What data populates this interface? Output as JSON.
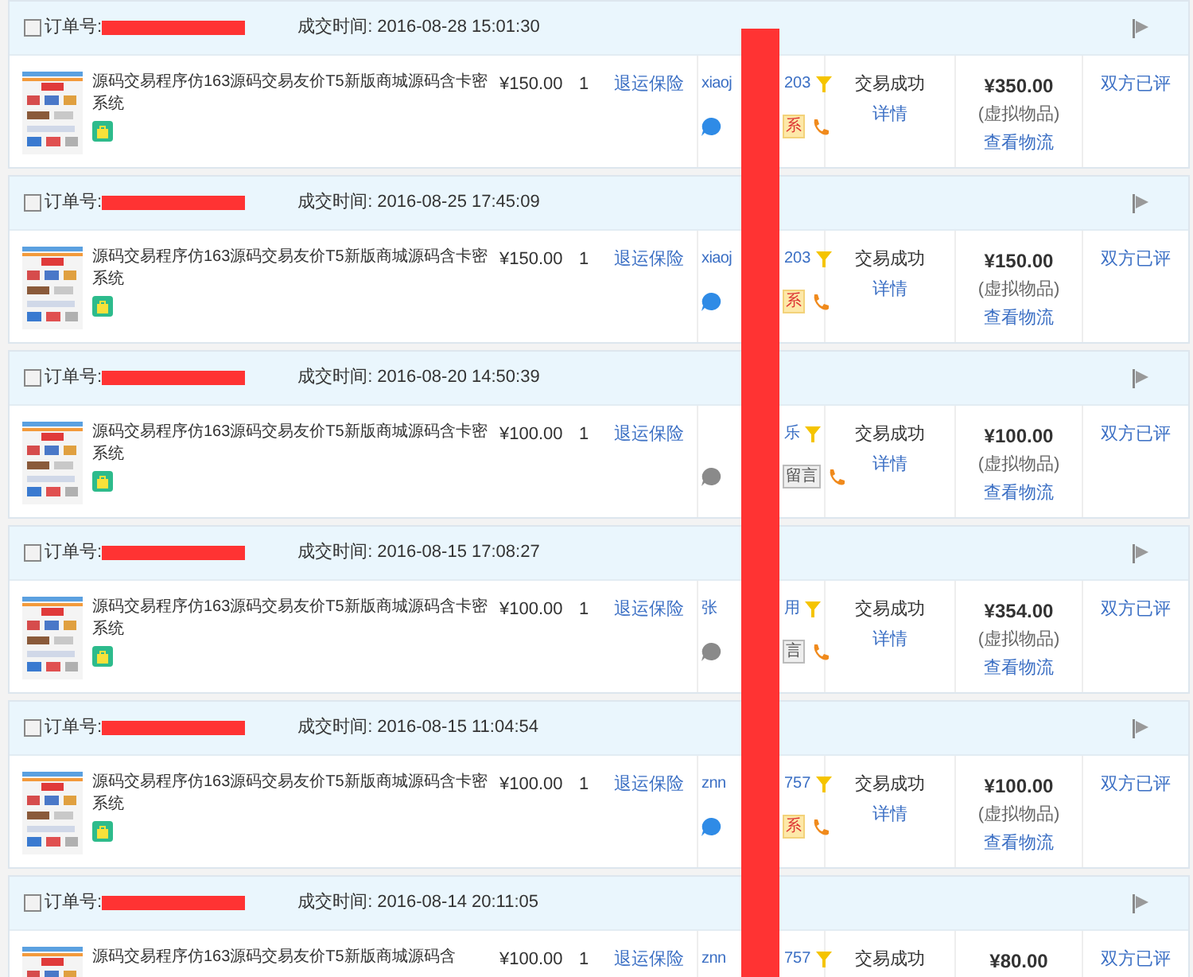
{
  "orders": [
    {
      "order_label": "订单号:",
      "time": "成交时间: 2016-08-28 15:01:30",
      "checked": false,
      "title": "源码交易程序仿163源码交易友价T5新版商城源码含卡密系统",
      "price": "¥150.00",
      "qty": "1",
      "service": "退运保险",
      "buyer_start": "xiaoj",
      "buyer_end": "203",
      "online": true,
      "contact": "系",
      "status": "交易成功",
      "detail": "详情",
      "total": "¥350.00",
      "note": "(虚拟物品)",
      "logistics": "查看物流",
      "review": "双方已评"
    },
    {
      "order_label": "订单号:",
      "time": "成交时间: 2016-08-25 17:45:09",
      "checked": false,
      "title": "源码交易程序仿163源码交易友价T5新版商城源码含卡密系统",
      "price": "¥150.00",
      "qty": "1",
      "service": "退运保险",
      "buyer_start": "xiaoj",
      "buyer_end": "203",
      "online": true,
      "contact": "系",
      "status": "交易成功",
      "detail": "详情",
      "total": "¥150.00",
      "note": "(虚拟物品)",
      "logistics": "查看物流",
      "review": "双方已评"
    },
    {
      "order_label": "订单号:",
      "time": "成交时间: 2016-08-20 14:50:39",
      "checked": false,
      "title": "源码交易程序仿163源码交易友价T5新版商城源码含卡密系统",
      "price": "¥100.00",
      "qty": "1",
      "service": "退运保险",
      "buyer_end": "乐",
      "online": false,
      "contact": "留言",
      "status": "交易成功",
      "detail": "详情",
      "total": "¥100.00",
      "note": "(虚拟物品)",
      "logistics": "查看物流",
      "review": "双方已评"
    },
    {
      "order_label": "订单号:",
      "time": "成交时间: 2016-08-15 17:08:27",
      "checked": false,
      "title": "源码交易程序仿163源码交易友价T5新版商城源码含卡密系统",
      "price": "¥100.00",
      "qty": "1",
      "service": "退运保险",
      "buyer_start": "张",
      "buyer_end": "用",
      "online": false,
      "contact": "言",
      "status": "交易成功",
      "detail": "详情",
      "total": "¥354.00",
      "note": "(虚拟物品)",
      "logistics": "查看物流",
      "review": "双方已评"
    },
    {
      "order_label": "订单号:",
      "time": "成交时间: 2016-08-15 11:04:54",
      "checked": false,
      "title": "源码交易程序仿163源码交易友价T5新版商城源码含卡密系统",
      "price": "¥100.00",
      "qty": "1",
      "service": "退运保险",
      "buyer_start": "znn",
      "buyer_end": "757",
      "online": true,
      "contact": "系",
      "status": "交易成功",
      "detail": "详情",
      "total": "¥100.00",
      "note": "(虚拟物品)",
      "logistics": "查看物流",
      "review": "双方已评"
    },
    {
      "order_label": "订单号:",
      "time": "成交时间: 2016-08-14 20:11:05",
      "checked": false,
      "title": "源码交易程序仿163源码交易友价T5新版商城源码含",
      "price": "¥100.00",
      "qty": "1",
      "service": "退运保险",
      "buyer_start": "znn",
      "buyer_end": "757",
      "status": "交易成功",
      "total": "¥80.00",
      "review": "双方已评"
    }
  ]
}
